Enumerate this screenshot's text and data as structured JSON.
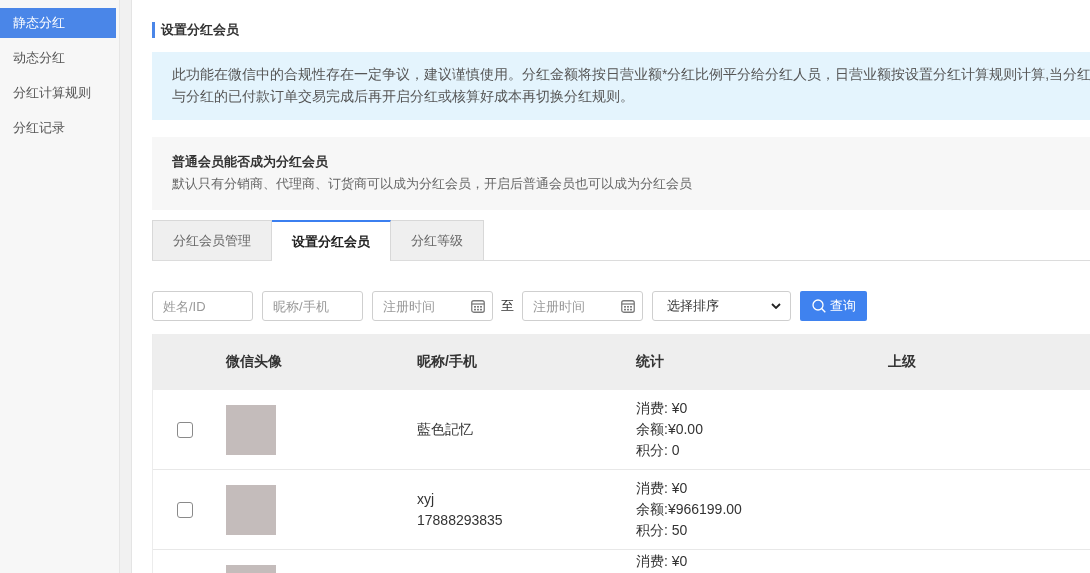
{
  "sidebar": {
    "items": [
      {
        "label": "静态分红",
        "selected": true
      },
      {
        "label": "动态分红",
        "selected": false
      },
      {
        "label": "分红计算规则",
        "selected": false
      },
      {
        "label": "分红记录",
        "selected": false
      }
    ]
  },
  "page_title": "设置分红会员",
  "notice": {
    "lines": [
      "此功能在微信中的合规性存在一定争议，建议谨慎使用。分红金额将按日营业额*分红比例平分给分红人员，日营业额按设置分红计算规则计算,当分红",
      "与分红的已付款订单交易完成后再开启分红或核算好成本再切换分红规则。"
    ]
  },
  "setting": {
    "title": "普通会员能否成为分红会员",
    "description": "默认只有分销商、代理商、订货商可以成为分红会员，开启后普通会员也可以成为分红会员"
  },
  "tabs": [
    {
      "label": "分红会员管理",
      "selected": false
    },
    {
      "label": "设置分红会员",
      "selected": true
    },
    {
      "label": "分红等级",
      "selected": false
    }
  ],
  "filters": {
    "fields": [
      {
        "kind": "text",
        "placeholder": "姓名/ID"
      },
      {
        "kind": "text",
        "placeholder": "昵称/手机"
      },
      {
        "kind": "date",
        "placeholder": "注册时间"
      },
      {
        "kind": "label",
        "text": "至"
      },
      {
        "kind": "date",
        "placeholder": "注册时间"
      },
      {
        "kind": "select",
        "value": "选择排序"
      }
    ],
    "button": "查询"
  },
  "table": {
    "columns": [
      "微信头像",
      "昵称/手机",
      "统计",
      "上级"
    ],
    "rows": [
      {
        "checked": false,
        "nickname": "藍色記忆",
        "stats": [
          "消费: ¥0",
          "余额:¥0.00",
          "积分: 0"
        ]
      },
      {
        "checked": false,
        "nickname": "xyj",
        "phone": "17888293835",
        "stats": [
          "消费: ¥0",
          "余额:¥966199.00",
          "积分: 50"
        ]
      }
    ],
    "cut_row": {
      "stats": [
        "消费: ¥0"
      ]
    }
  }
}
